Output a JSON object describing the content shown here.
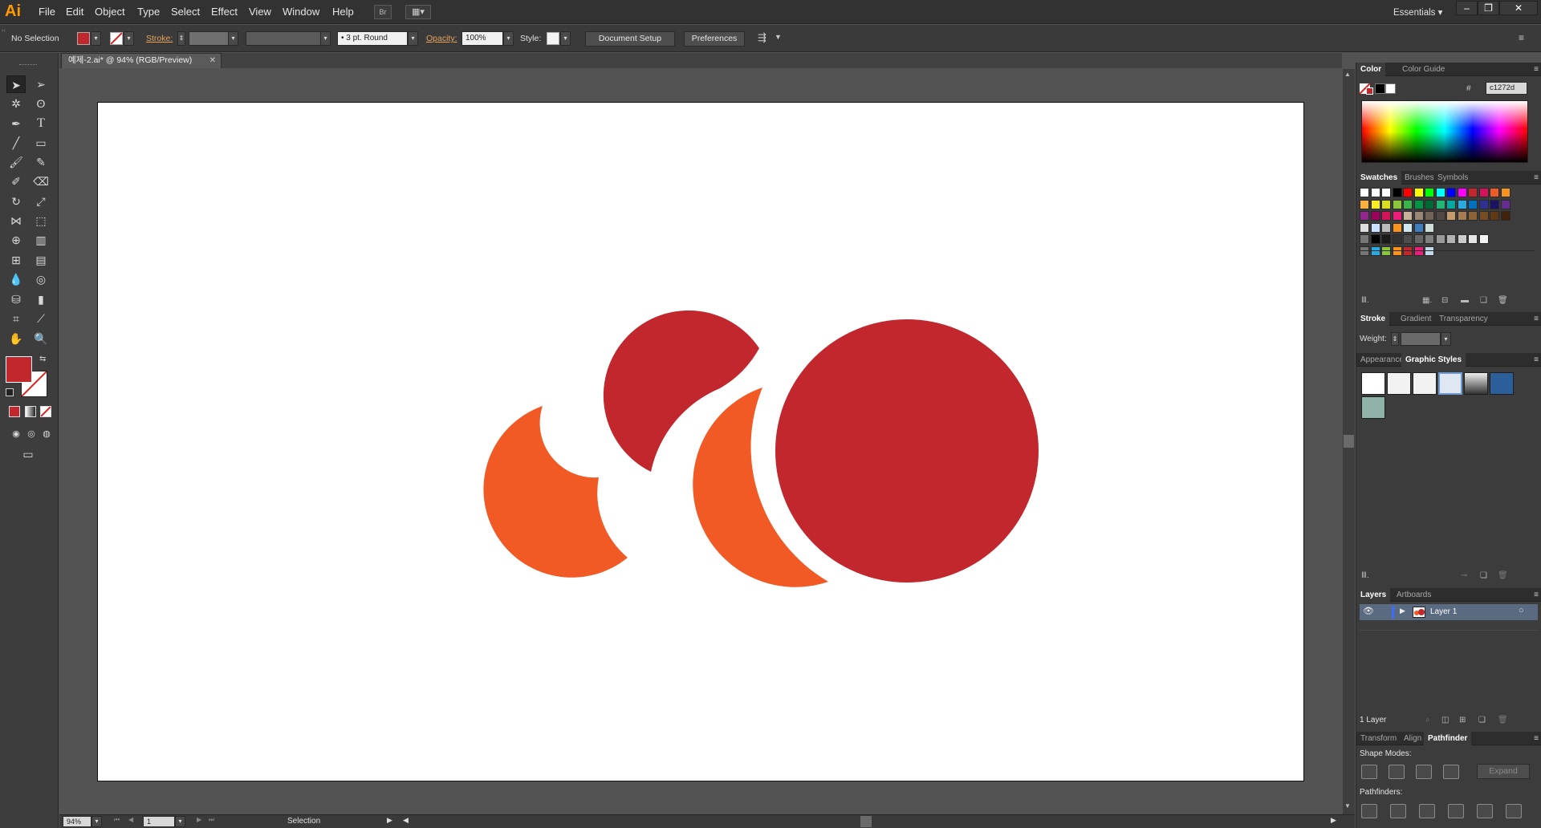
{
  "app": {
    "logo": "Ai"
  },
  "menu": [
    "File",
    "Edit",
    "Object",
    "Type",
    "Select",
    "Effect",
    "View",
    "Window",
    "Help"
  ],
  "workspace": {
    "label": "Essentials"
  },
  "control_bar": {
    "selection": "No Selection",
    "stroke_label": "Stroke:",
    "brush_label": "3 pt. Round",
    "opacity_label": "Opacity:",
    "opacity_value": "100%",
    "style_label": "Style:",
    "document_setup": "Document Setup",
    "preferences": "Preferences"
  },
  "document": {
    "tab_title": "예제-2.ai* @ 94% (RGB/Preview)"
  },
  "status": {
    "zoom": "94%",
    "artboard": "1",
    "tool": "Selection"
  },
  "colors": {
    "fill": "#c1272d",
    "orange": "#f15a24",
    "hex_value": "c1272d"
  },
  "panels": {
    "color": {
      "tabs": [
        "Color",
        "Color Guide"
      ],
      "hex": "c1272d"
    },
    "swatches": {
      "tabs": [
        "Swatches",
        "Brushes",
        "Symbols"
      ]
    },
    "stroke": {
      "tabs": [
        "Stroke",
        "Gradient",
        "Transparency"
      ],
      "weight_label": "Weight:"
    },
    "graphic_styles": {
      "tabs": [
        "Appearance",
        "Graphic Styles"
      ]
    },
    "layers": {
      "tabs": [
        "Layers",
        "Artboards"
      ],
      "layer_name": "Layer 1",
      "count": "1 Layer"
    },
    "pathfinder": {
      "tabs": [
        "Transform",
        "Align",
        "Pathfinder"
      ],
      "shape_modes": "Shape Modes:",
      "pathfinders": "Pathfinders:",
      "expand": "Expand"
    }
  }
}
